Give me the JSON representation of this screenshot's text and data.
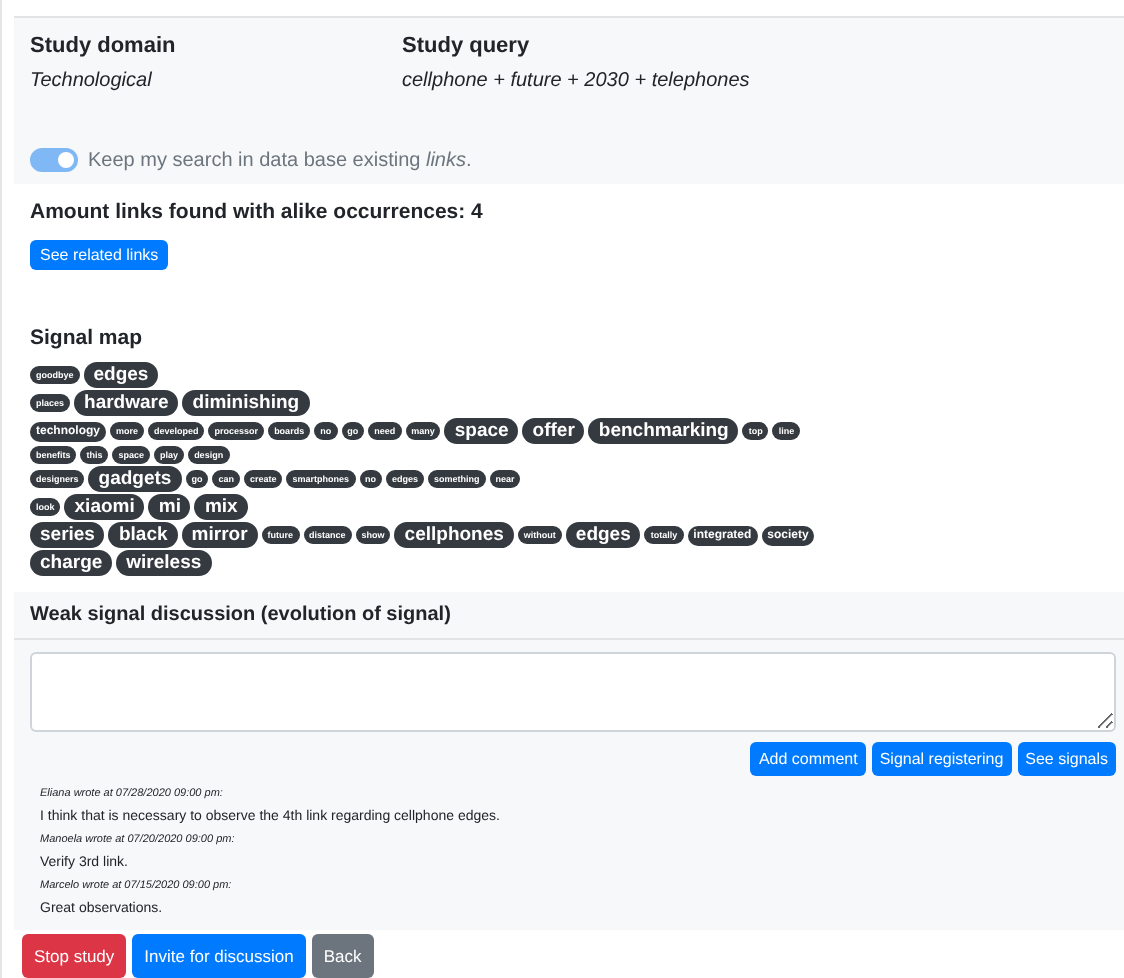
{
  "study": {
    "domain_label": "Study domain",
    "domain": "Technological",
    "query_label": "Study query",
    "query": "cellphone + future + 2030 + telephones"
  },
  "keep_search": {
    "on": true,
    "label": "Keep my search in data base existing *links*."
  },
  "links": {
    "amount": "Amount links found with alike occurrences: 4",
    "button": "See related links"
  },
  "signal_map": {
    "title": "Signal map",
    "lines": [
      {
        "tags": [
          {
            "text": "goodbye",
            "kind": "small"
          },
          {
            "text": "edges",
            "kind": "large"
          }
        ]
      },
      {
        "tags": [
          {
            "text": "places",
            "kind": "small"
          },
          {
            "text": "hardware",
            "kind": "large"
          },
          {
            "text": "diminishing",
            "kind": "large"
          }
        ]
      },
      {
        "tags": [
          {
            "text": "technology",
            "kind": "medium"
          },
          {
            "text": "more",
            "kind": "small"
          },
          {
            "text": "developed",
            "kind": "small"
          },
          {
            "text": "processor",
            "kind": "small"
          },
          {
            "text": "boards",
            "kind": "small"
          },
          {
            "text": "no",
            "kind": "small"
          },
          {
            "text": "go",
            "kind": "small"
          },
          {
            "text": "need",
            "kind": "small"
          },
          {
            "text": "many",
            "kind": "small"
          },
          {
            "text": "space",
            "kind": "large"
          },
          {
            "text": "offer",
            "kind": "large"
          },
          {
            "text": "benchmarking",
            "kind": "large"
          },
          {
            "text": "top",
            "kind": "small"
          },
          {
            "text": "line",
            "kind": "small"
          }
        ]
      },
      {
        "tags": [
          {
            "text": "benefits",
            "kind": "small"
          },
          {
            "text": "this",
            "kind": "small"
          },
          {
            "text": "space",
            "kind": "small"
          },
          {
            "text": "play",
            "kind": "small"
          },
          {
            "text": "design",
            "kind": "small"
          }
        ]
      },
      {
        "tags": [
          {
            "text": "designers",
            "kind": "small"
          },
          {
            "text": "gadgets",
            "kind": "large"
          },
          {
            "text": "go",
            "kind": "small"
          },
          {
            "text": "can",
            "kind": "small"
          },
          {
            "text": "create",
            "kind": "small"
          },
          {
            "text": "smartphones",
            "kind": "small"
          },
          {
            "text": "no",
            "kind": "small"
          },
          {
            "text": "edges",
            "kind": "small"
          },
          {
            "text": "something",
            "kind": "small"
          },
          {
            "text": "near",
            "kind": "small"
          }
        ]
      },
      {
        "tags": [
          {
            "text": "look",
            "kind": "small"
          },
          {
            "text": "xiaomi",
            "kind": "large"
          },
          {
            "text": "mi",
            "kind": "large"
          },
          {
            "text": "mix",
            "kind": "large"
          }
        ]
      },
      {
        "tags": [
          {
            "text": "series",
            "kind": "large"
          },
          {
            "text": "black",
            "kind": "large"
          },
          {
            "text": "mirror",
            "kind": "large"
          },
          {
            "text": "future",
            "kind": "small"
          },
          {
            "text": "distance",
            "kind": "small"
          },
          {
            "text": "show",
            "kind": "small"
          },
          {
            "text": "cellphones",
            "kind": "large"
          },
          {
            "text": "without",
            "kind": "small"
          },
          {
            "text": "edges",
            "kind": "large"
          },
          {
            "text": "totally",
            "kind": "small"
          },
          {
            "text": "integrated",
            "kind": "medium"
          },
          {
            "text": "society",
            "kind": "medium"
          }
        ]
      },
      {
        "tags": [
          {
            "text": "charge",
            "kind": "large"
          },
          {
            "text": "wireless",
            "kind": "large"
          }
        ]
      }
    ]
  },
  "discussion": {
    "title": "Weak signal discussion (evolution of signal)",
    "buttons": [
      "Add comment",
      "Signal registering",
      "See signals"
    ],
    "comments": [
      {
        "author_line": "Eliana wrote at 07/28/2020 09:00 pm:",
        "text": "I think that is necessary to observe the 4th link regarding cellphone edges."
      },
      {
        "author_line": "Manoela wrote at 07/20/2020 09:00 pm:",
        "text": "Verify 3rd link."
      },
      {
        "author_line": "Marcelo wrote at 07/15/2020 09:00 pm:",
        "text": "Great observations."
      }
    ]
  },
  "actions": [
    {
      "label": "Stop study",
      "kind": "danger"
    },
    {
      "label": "Invite for discussion",
      "kind": "primary"
    },
    {
      "label": "Back",
      "kind": "secondary"
    }
  ]
}
